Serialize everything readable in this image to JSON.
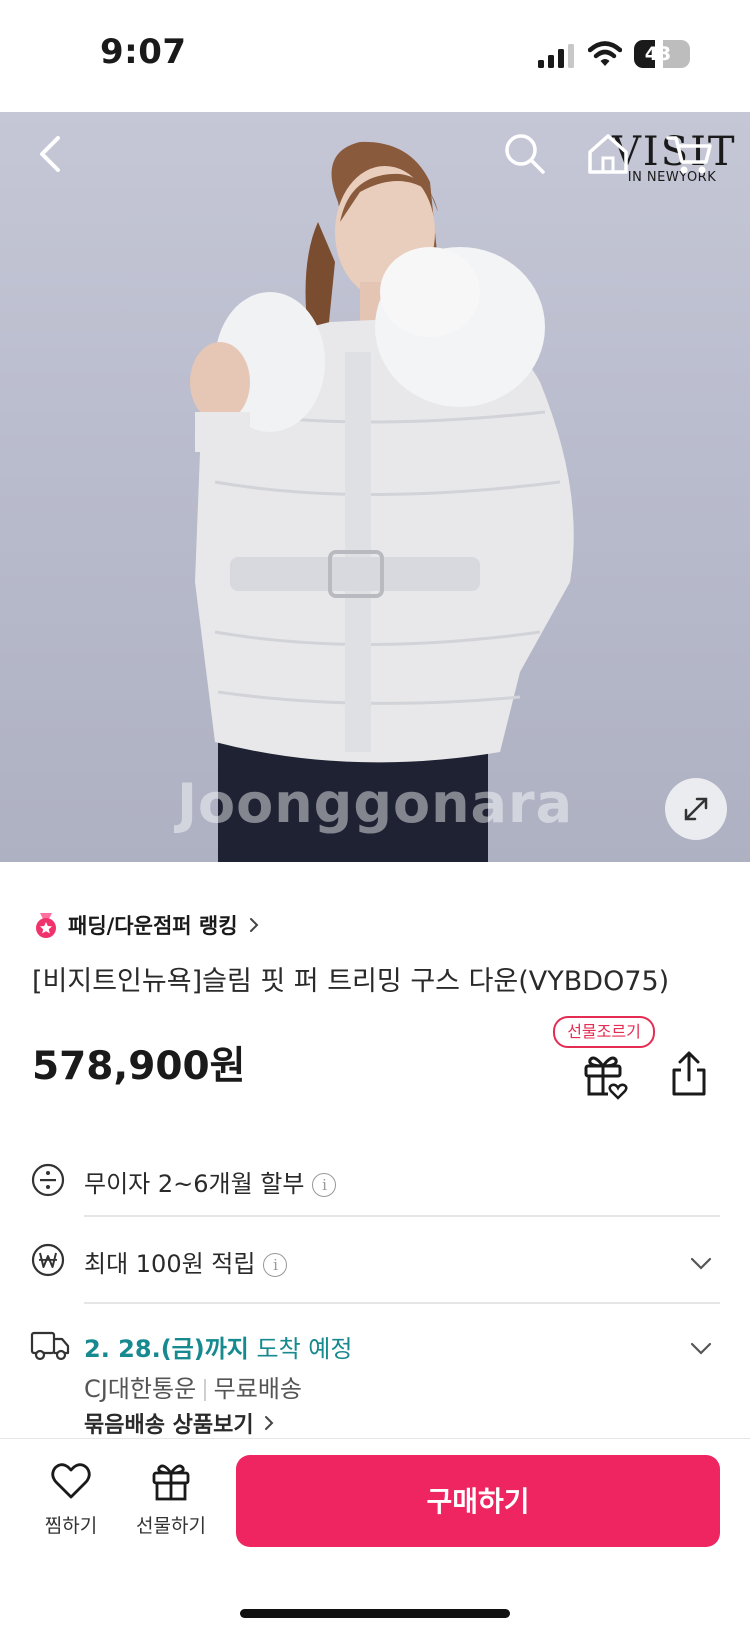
{
  "status_bar": {
    "time": "9:07",
    "battery": "43",
    "battery_fraction": 0.43
  },
  "hero": {
    "brand_logo_main": "VISIT",
    "brand_logo_sub": "IN NEWYORK",
    "watermark": "Joonggonara",
    "icons": {
      "back": "back-arrow-icon",
      "search": "search-icon",
      "home": "home-icon",
      "cart": "cart-icon",
      "expand": "expand-icon"
    }
  },
  "product": {
    "ranking_label": "패딩/다운점퍼 랭킹",
    "title": "[비지트인뉴욕]슬림 핏 퍼 트리밍 구스 다운(VYBDO75)",
    "price": "578,900원",
    "gift_badge": "선물조르기"
  },
  "benefits": {
    "installment": "무이자 2~6개월 할부",
    "points": "최대 100원 적립",
    "info_glyph": "i"
  },
  "delivery": {
    "date": "2. 28.(금)까지",
    "arrival": " 도착 예정",
    "carrier": "CJ대한통운",
    "shipping": "무료배송",
    "bundle_link": "묶음배송 상품보기"
  },
  "bottom_bar": {
    "wishlist_label": "찜하기",
    "gift_label": "선물하기",
    "buy_label": "구매하기"
  },
  "colors": {
    "accent": "#ee2560",
    "delivery": "#168a8f",
    "badge": "#e52c52"
  }
}
